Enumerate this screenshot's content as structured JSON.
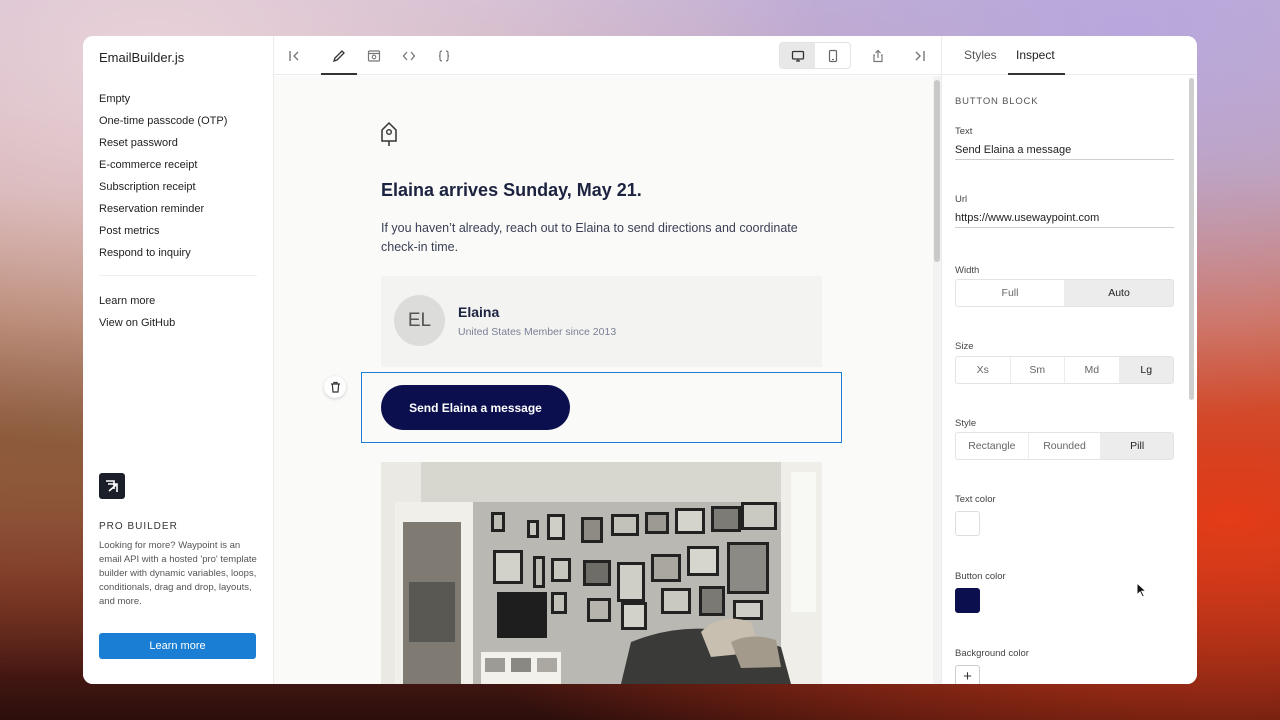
{
  "sidebar": {
    "brand": "EmailBuilder.js",
    "templates": [
      "Empty",
      "One-time passcode (OTP)",
      "Reset password",
      "E-commerce receipt",
      "Subscription receipt",
      "Reservation reminder",
      "Post metrics",
      "Respond to inquiry"
    ],
    "links": [
      "Learn more",
      "View on GitHub"
    ],
    "pro": {
      "title": "PRO BUILDER",
      "description": "Looking for more? Waypoint is an email API with a hosted 'pro' template builder with dynamic variables, loops, conditionals, drag and drop, layouts, and more.",
      "button": "Learn more"
    }
  },
  "toolbar": {
    "icons": [
      "collapse-left-icon",
      "pencil-icon",
      "preview-icon",
      "html-code-icon",
      "json-code-icon",
      "desktop-icon",
      "mobile-icon",
      "share-icon",
      "collapse-right-icon"
    ],
    "active_tab": "pencil-icon",
    "active_device": "desktop"
  },
  "email": {
    "heading": "Elaina arrives Sunday, May 21.",
    "body": "If you haven’t already, reach out to Elaina to send directions and coordinate check-in time.",
    "profile": {
      "initials": "EL",
      "name": "Elaina",
      "subtitle": "United States Member since 2013"
    },
    "button_label": "Send Elaina a message"
  },
  "inspector": {
    "tabs": [
      "Styles",
      "Inspect"
    ],
    "active_tab": "Inspect",
    "block_title": "BUTTON BLOCK",
    "text_label": "Text",
    "text_value": "Send Elaina a message",
    "url_label": "Url",
    "url_value": "https://www.usewaypoint.com",
    "width_label": "Width",
    "width_options": [
      "Full",
      "Auto"
    ],
    "width_selected": "Auto",
    "size_label": "Size",
    "size_options": [
      "Xs",
      "Sm",
      "Md",
      "Lg"
    ],
    "size_selected": "Lg",
    "style_label": "Style",
    "style_options": [
      "Rectangle",
      "Rounded",
      "Pill"
    ],
    "style_selected": "Pill",
    "text_color_label": "Text color",
    "text_color": "#FFFFFF",
    "button_color_label": "Button color",
    "button_color": "#0B0F4E",
    "background_color_label": "Background color",
    "add_symbol": "+"
  },
  "colors": {
    "accent": "#1A7FD4",
    "heading": "#1C2340",
    "button": "#0B0F4E"
  }
}
